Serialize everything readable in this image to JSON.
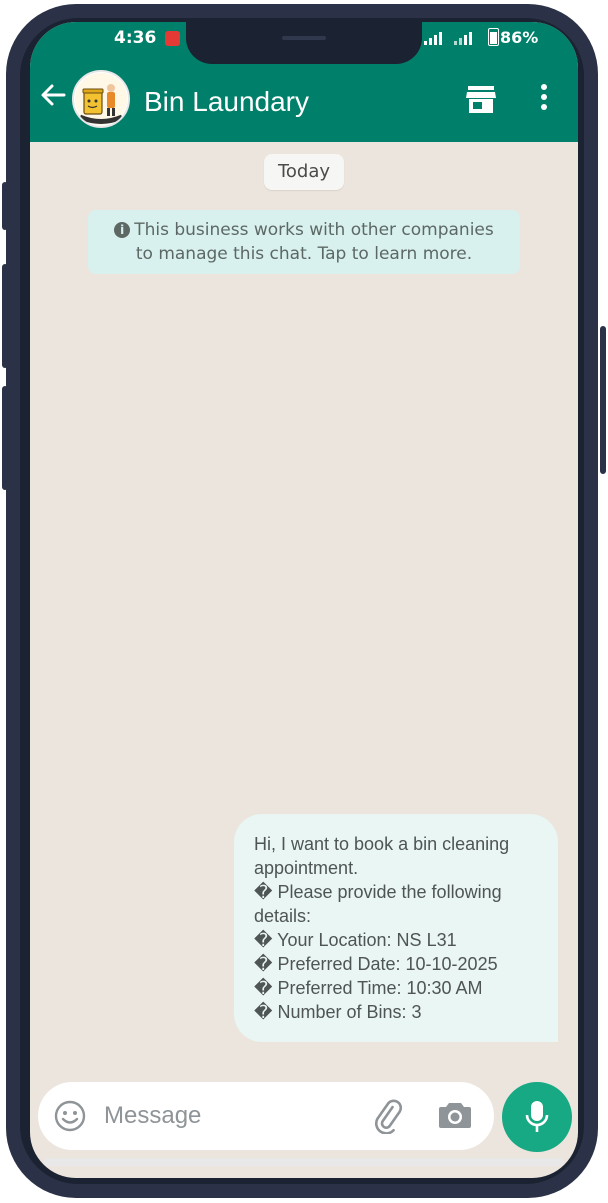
{
  "status_bar": {
    "time": "4:36",
    "battery": "86%"
  },
  "chat_header": {
    "title": "Bin Laundary",
    "avatar_icon": "bin-laundry-logo-icon",
    "back_icon": "back-arrow-icon",
    "store_icon": "store-icon",
    "menu_icon": "more-vert-icon"
  },
  "date_chip": "Today",
  "business_notice": {
    "icon": "info-icon",
    "line1": "This business works with other companies",
    "line2": "to manage this chat. Tap to learn more."
  },
  "message": {
    "lines": [
      "Hi, I want to book a bin cleaning",
      "appointment.",
      "� Please provide the following",
      "details:",
      "� Your Location:  NS L31",
      "� Preferred Date:  10-10-2025",
      "� Preferred Time:  10:30 AM",
      "� Number of Bins: 3"
    ]
  },
  "composer": {
    "placeholder": "Message",
    "emoji_icon": "emoji-icon",
    "attach_icon": "paperclip-icon",
    "camera_icon": "camera-icon",
    "mic_icon": "mic-icon"
  },
  "colors": {
    "header": "#00806a",
    "chat_bg": "#ece5dd",
    "bubble": "#e9f6f3",
    "notice": "#d8f1ee",
    "mic_button": "#17a884"
  }
}
